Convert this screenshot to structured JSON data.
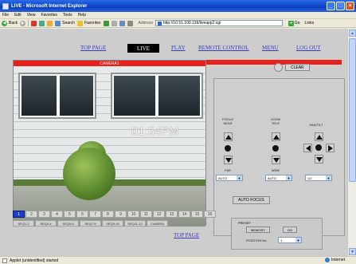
{
  "window": {
    "title": "LIVE - Microsoft Internet Explorer",
    "min": "_",
    "max": "□",
    "close": "×"
  },
  "menu": [
    "File",
    "Edit",
    "View",
    "Favorites",
    "Tools",
    "Help"
  ],
  "toolbar": {
    "back": "Back",
    "search": "Search",
    "favorites": "Favorites",
    "address_label": "Address",
    "address_value": "http://10.51.100.136/liveapp2.cgi",
    "go": "Go",
    "links": "Links"
  },
  "nav": {
    "top_page": "TOP PAGE",
    "live": "LIVE",
    "play": "PLAY",
    "remote_control": "REMOTE CONTROL",
    "menu": "MENU",
    "log_out": "LOG OUT"
  },
  "camera": {
    "header": "CAMERA1",
    "timestamp": "01:54PM"
  },
  "clear_label": "CLEAR",
  "controls": {
    "focus_label_1": "FOCUS",
    "focus_label_2": "NEAR",
    "zoom_label_1": "ZOOM",
    "zoom_label_2": "TELE",
    "pantilt_label": "PAN/TILT",
    "far_label": "FAR",
    "wide_label": "WIDE",
    "focus_select": "AUTO",
    "zoom_select": "AUTO",
    "pantilt_select": "1/2"
  },
  "auto_focus": "AUTO FOCUS",
  "preset": {
    "title": "PRESET",
    "memory": "MEMORY",
    "go": "GO",
    "position_label": "POSITION No.",
    "position_value": "1"
  },
  "channels": [
    "1",
    "2",
    "3",
    "4",
    "5",
    "6",
    "7",
    "8",
    "9",
    "10",
    "11",
    "12",
    "13",
    "14",
    "15",
    "16"
  ],
  "preset_buttons": [
    "SEQ1-2",
    "SEQ3-4",
    "SEQ5-6",
    "SEQ7-8",
    "SEQ9-10",
    "SEQ11-12",
    "CAMERA"
  ],
  "bottom_link": "TOP PAGE",
  "status": {
    "text": "Applet (unidentified) started",
    "zone": "Internet"
  },
  "colors": {
    "red_bar": "#e8201a",
    "link": "#3b3bbf",
    "active_channel": "#1a40c8"
  }
}
